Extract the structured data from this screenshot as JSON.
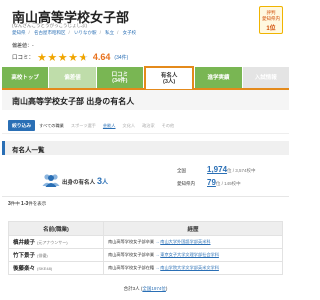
{
  "school": {
    "name": "南山高等学校女子部",
    "reading": "(なんざんこうとうがっこうじょしぶ)",
    "info": [
      "愛知県",
      "名古屋市昭和区",
      "いりなか駅",
      "私立",
      "女子校"
    ]
  },
  "badge": {
    "line1": "評判",
    "line2": "愛知県内",
    "line3": "1位"
  },
  "deviation": {
    "label": "偏差値：",
    "value": "-"
  },
  "review": {
    "label": "口コミ：",
    "stars": 4.64,
    "score": "4.64",
    "count": "(34件)"
  },
  "tabs": [
    {
      "label": "高校トップ",
      "sub": ""
    },
    {
      "label": "偏差値",
      "sub": ""
    },
    {
      "label": "口コミ",
      "sub": "(34件)"
    },
    {
      "label": "有名人",
      "sub": "(3人)"
    },
    {
      "label": "進学実績",
      "sub": ""
    },
    {
      "label": "入試情報",
      "sub": ""
    }
  ],
  "page_heading": "南山高等学校女子部 出身の有名人",
  "filter": {
    "button": "絞り込み",
    "items": [
      "すべての職業",
      "スポーツ選手",
      "芸能人",
      "文化人",
      "政治家",
      "その他"
    ]
  },
  "section_title": "有名人一覧",
  "summary": {
    "label": "出身の有名人",
    "count": "3",
    "unit": "人"
  },
  "rankings": [
    {
      "label": "全国",
      "value": "1,974",
      "suffix": "位",
      "total": "/ 3,574校中"
    },
    {
      "label": "愛知県内",
      "value": "79",
      "suffix": "位",
      "total": "/ 149校中"
    }
  ],
  "paging": {
    "total": "3",
    "text_mid": "件中 ",
    "range": "1-3",
    "text_end": "件を表示"
  },
  "table": {
    "headers": [
      "名前(職業)",
      "経歴"
    ],
    "rows": [
      {
        "name": "槙井綾子",
        "role": "(元アナウンサー)",
        "from": "南山高等学校女子部卒業",
        "to": "南山大学外国語学部英米科"
      },
      {
        "name": "竹下景子",
        "role": "(俳優)",
        "from": "南山高等学校女子部卒業",
        "to": "東京女子大学文理学部社会学科"
      },
      {
        "name": "後藤楽々",
        "role": "(SKE48)",
        "from": "南山高等学校女子部在籍",
        "to": "南山学院大学文学部英米文学科"
      }
    ]
  },
  "footer": {
    "prefix": "合計3人 (",
    "link": "全国1974位",
    "suffix": ")"
  }
}
